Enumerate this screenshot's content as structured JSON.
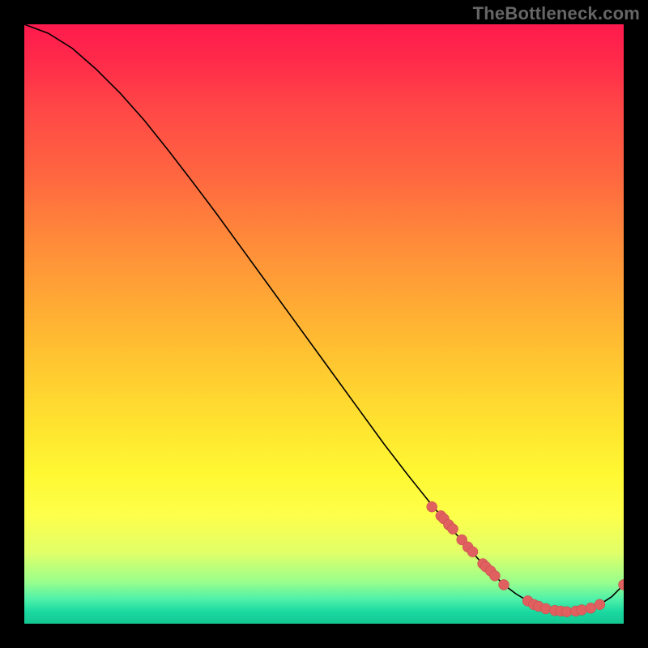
{
  "watermark": "TheBottleneck.com",
  "chart_data": {
    "type": "line",
    "title": "",
    "xlabel": "",
    "ylabel": "",
    "xlim": [
      0,
      100
    ],
    "ylim": [
      0,
      100
    ],
    "curve": {
      "x": [
        0,
        4,
        8,
        12,
        16,
        20,
        24,
        28,
        32,
        36,
        40,
        44,
        48,
        52,
        56,
        60,
        64,
        68,
        72,
        76,
        80,
        82,
        84,
        86,
        88,
        90,
        92,
        94,
        96,
        98,
        100
      ],
      "y": [
        100,
        98.5,
        96,
        92.5,
        88.5,
        84,
        79,
        73.8,
        68.5,
        63,
        57.5,
        52,
        46.5,
        41,
        35.5,
        30,
        24.8,
        19.8,
        15,
        10.5,
        6.5,
        5,
        3.8,
        2.8,
        2.2,
        2,
        2.1,
        2.5,
        3.2,
        4.5,
        6.5
      ]
    },
    "points": [
      {
        "x": 68,
        "y": 19.5
      },
      {
        "x": 69.5,
        "y": 18
      },
      {
        "x": 70,
        "y": 17.5
      },
      {
        "x": 70.8,
        "y": 16.5
      },
      {
        "x": 71.5,
        "y": 15.8
      },
      {
        "x": 73,
        "y": 14
      },
      {
        "x": 74,
        "y": 12.8
      },
      {
        "x": 74.8,
        "y": 12
      },
      {
        "x": 76.5,
        "y": 10
      },
      {
        "x": 77,
        "y": 9.5
      },
      {
        "x": 77.8,
        "y": 8.8
      },
      {
        "x": 78.5,
        "y": 8
      },
      {
        "x": 80,
        "y": 6.5
      },
      {
        "x": 84,
        "y": 3.8
      },
      {
        "x": 85,
        "y": 3.2
      },
      {
        "x": 85.8,
        "y": 2.9
      },
      {
        "x": 87,
        "y": 2.5
      },
      {
        "x": 88.5,
        "y": 2.2
      },
      {
        "x": 89.5,
        "y": 2.1
      },
      {
        "x": 90.5,
        "y": 2.0
      },
      {
        "x": 92,
        "y": 2.1
      },
      {
        "x": 93,
        "y": 2.3
      },
      {
        "x": 94.5,
        "y": 2.6
      },
      {
        "x": 96,
        "y": 3.2
      },
      {
        "x": 100,
        "y": 6.5
      }
    ],
    "colors": {
      "curve": "#000000",
      "point_fill": "#e06060",
      "point_stroke": "#c04848"
    }
  }
}
